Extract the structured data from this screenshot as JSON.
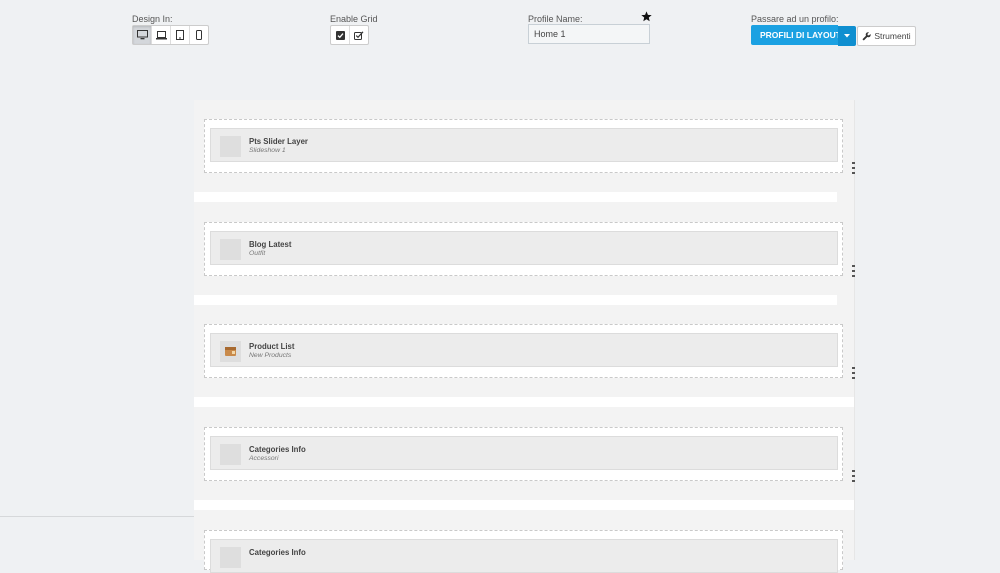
{
  "toolbar": {
    "design_label": "Design In:",
    "grid_label": "Enable Grid",
    "profile_name_label": "Profile Name:",
    "profile_name_value": "Home 1",
    "switch_label": "Passare ad un profilo:",
    "layout_button": "PROFILI DI LAYOUT",
    "tools_button": "Strumenti",
    "devices": [
      "desktop-icon",
      "laptop-icon",
      "tablet-icon",
      "mobile-icon"
    ],
    "accent_color": "#1ba1e2"
  },
  "modules": [
    {
      "title": "Pts Slider Layer",
      "subtitle": "Slideshow 1",
      "icon": "placeholder"
    },
    {
      "title": "Blog Latest",
      "subtitle": "Outfit",
      "icon": "placeholder"
    },
    {
      "title": "Product List",
      "subtitle": "New Products",
      "icon": "product-list-icon"
    },
    {
      "title": "Categories Info",
      "subtitle": "Accessori",
      "icon": "placeholder"
    },
    {
      "title": "Categories Info",
      "subtitle": "",
      "icon": "placeholder"
    }
  ]
}
